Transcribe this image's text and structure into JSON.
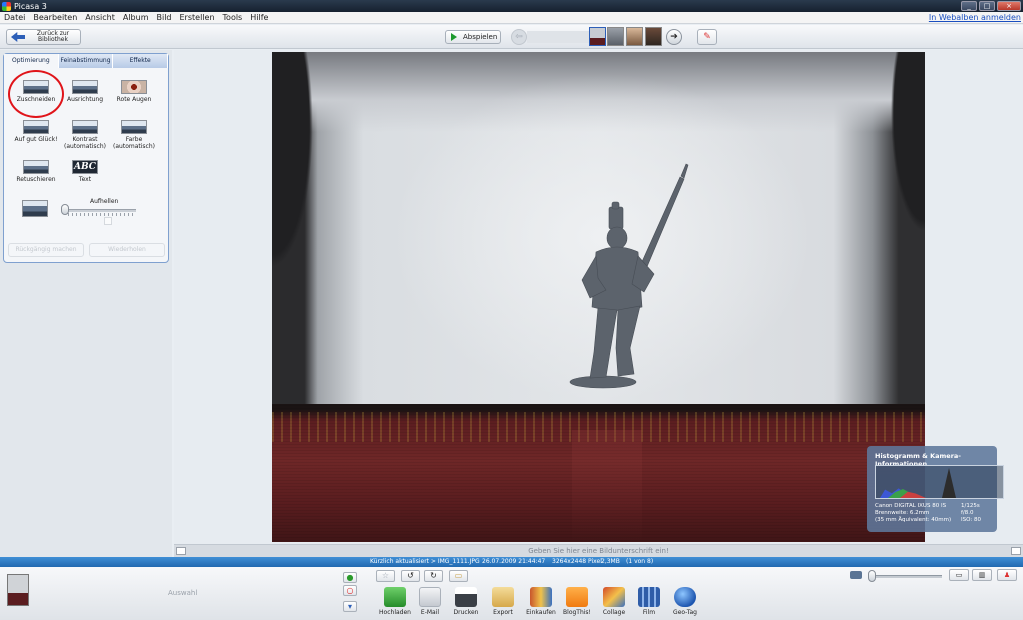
{
  "window": {
    "title": "Picasa 3",
    "minimize": "_",
    "maximize": "□",
    "close": "×"
  },
  "menu": [
    "Datei",
    "Bearbeiten",
    "Ansicht",
    "Album",
    "Bild",
    "Erstellen",
    "Tools",
    "Hilfe"
  ],
  "web_link": "In Webalben anmelden",
  "toolbar": {
    "back_label": "Zurück zur Bibliothek",
    "play_label": "Abspielen",
    "prev": "⇦",
    "next": "➔",
    "color_icon": "✎"
  },
  "tabs": [
    "Optimierung",
    "Feinabstimmung",
    "Effekte"
  ],
  "tools": {
    "crop": "Zuschneiden",
    "straighten": "Ausrichtung",
    "redeye": "Rote Augen",
    "feeling_lucky": "Auf gut Glück!",
    "contrast": "Kontrast (automatisch)",
    "color": "Farbe (automatisch)",
    "retouch": "Retuschieren",
    "text": "Text",
    "text_icon_label": "ABC",
    "fill_light": "Aufhellen"
  },
  "panel_buttons": {
    "undo": "Rückgängig machen",
    "redo": "Wiederholen"
  },
  "histogram": {
    "title": "Histogramm & Kamera-Informationen",
    "camera": "Canon DIGITAL IXUS 80 IS",
    "focal": "Brennweite: 6.2mm",
    "equiv": "(35 mm Äquivalent: 40mm)",
    "shutter": "1/125s",
    "aperture": "f/8.0",
    "iso": "ISO: 80"
  },
  "caption_placeholder": "Geben Sie hier eine Bildunterschrift ein!",
  "status": {
    "path": "Kürzlich aktualisiert > IMG_1111.JPG",
    "date": "26.07.2009 21:44:47",
    "dims": "3264x2448 Pixel",
    "size": "2,3MB",
    "count": "(1 von 8)"
  },
  "tray": {
    "selection_label": "Auswahl",
    "actions": [
      "Hochladen",
      "E-Mail",
      "Drucken",
      "Export",
      "Einkaufen",
      "BlogThis!",
      "Collage",
      "Film",
      "Geo-Tag"
    ]
  },
  "colors": {
    "accent": "#2d5fb8",
    "status_bar": "#2d7cc4",
    "highlight_ring": "#e0141a"
  }
}
